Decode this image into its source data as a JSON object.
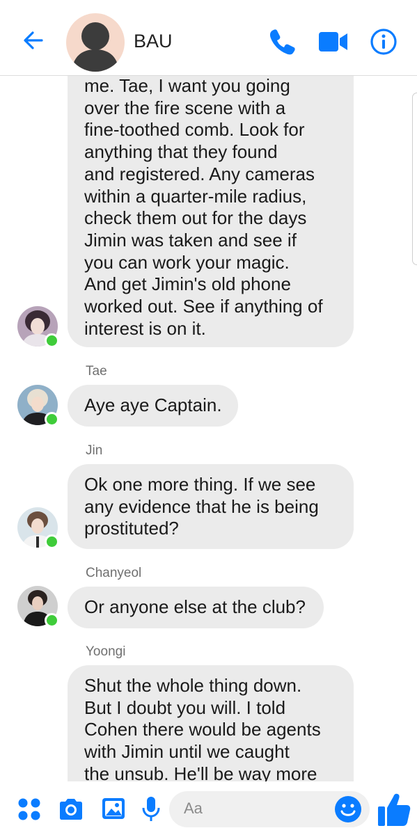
{
  "header": {
    "title": "BAU",
    "back_icon": "back-arrow-icon",
    "call_icon": "phone-icon",
    "video_icon": "video-camera-icon",
    "info_icon": "info-icon"
  },
  "messages": [
    {
      "lines": [
        "me. Tae, I want you going",
        "over the fire scene with a",
        "fine-toothed comb. Look for",
        "anything that they found",
        "and registered. Any cameras",
        "within a quarter-mile radius,",
        "check them out for the days",
        "Jimin was taken and see if",
        "you can work your magic.",
        "And get Jimin's old phone",
        "worked out. See if anything of",
        "interest is on it."
      ]
    },
    {
      "sender": "Tae",
      "lines": [
        "Aye aye Captain."
      ]
    },
    {
      "sender": "Jin",
      "lines": [
        "Ok one more thing. If we see",
        "any evidence that he is being",
        "prostituted?"
      ]
    },
    {
      "sender": "Chanyeol",
      "lines": [
        "Or anyone else at the club?"
      ]
    },
    {
      "sender": "Yoongi",
      "lines": [
        "Shut the whole thing down.",
        "But I doubt you will. I told",
        "Cohen there would be agents",
        "with Jimin until we caught",
        "the unsub. He'll be way more"
      ]
    }
  ],
  "composer": {
    "placeholder": "Aa",
    "icons": [
      "apps-dots-icon",
      "camera-icon",
      "image-icon",
      "microphone-icon",
      "emoji-icon",
      "thumbs-up-icon"
    ]
  },
  "colors": {
    "accent": "#0a7cff",
    "bubble": "#ebebeb",
    "online": "#3fcc3a"
  }
}
